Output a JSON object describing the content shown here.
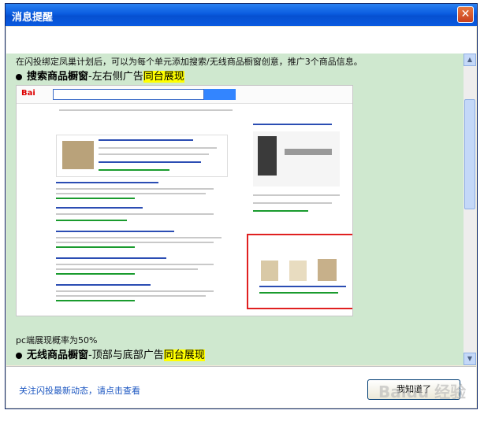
{
  "window": {
    "title": "消息提醒"
  },
  "content": {
    "intro": "在闪投绑定凤巢计划后，可以为每个单元添加搜索/无线商品橱窗创意，推广3个商品信息。",
    "section1": {
      "title": "搜索商品橱窗",
      "subtitle": "-左右侧广告",
      "highlight": "同台展现"
    },
    "pc_probability": "pc端展现概率为50%",
    "section2": {
      "title": "无线商品橱窗",
      "subtitle": "-顶部与底部广告",
      "highlight": "同台展现"
    }
  },
  "footer": {
    "link_text": "关注闪投最新动态，请点击查看",
    "ok_button": "我知道了"
  },
  "watermark": "Baidu 经验",
  "colors": {
    "titlebar": "#0a5ce0",
    "background": "#cfe8cf",
    "highlight": "#ffff00",
    "redbox": "#e02020"
  }
}
